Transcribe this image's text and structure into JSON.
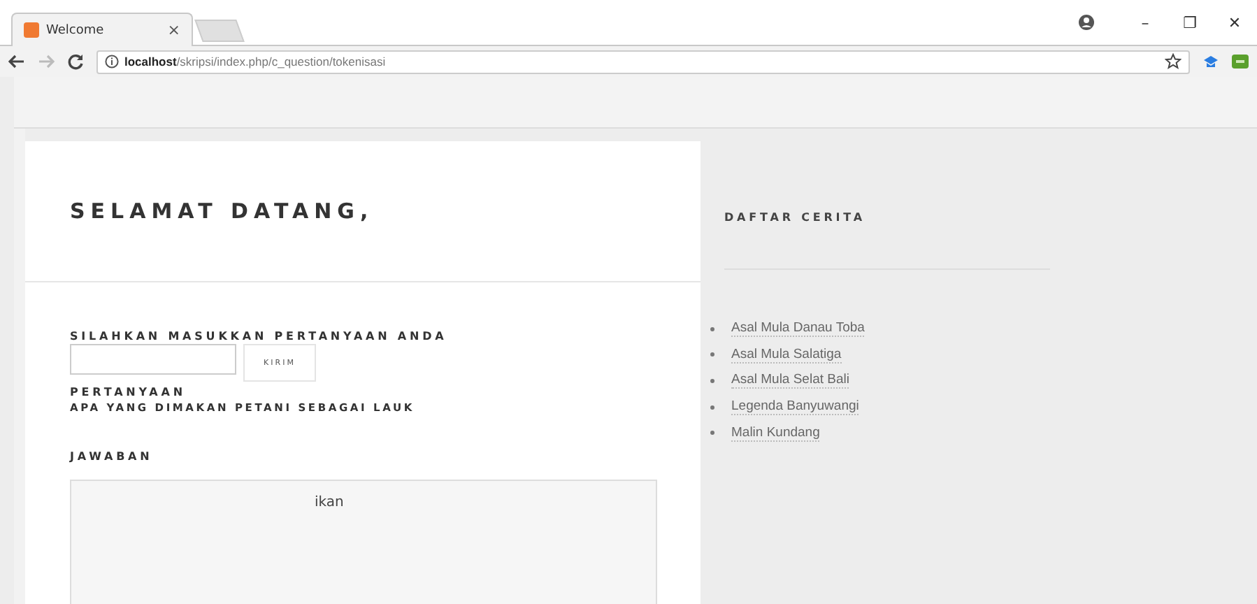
{
  "browser": {
    "tab_title": "Welcome",
    "close": "×",
    "url": "**localhost**/skripsi/index.php/c_question/tokenisasi",
    "window_controls": [
      "–",
      "❐",
      "✕"
    ]
  },
  "main": {
    "title": "SELAMAT DATANG,",
    "prompt": "SILAHKAN MASUKKAN PERTANYAAN ANDA",
    "submit": "KIRIM",
    "question_label": "PERTANYAAN",
    "question": "APA YANG DIMAKAN PETANI SEBAGAI LAUK",
    "answer_label": "JAWABAN",
    "answer": "ikan"
  },
  "sidebar": {
    "title": "DAFTAR CERITA",
    "items": [
      "Asal Mula Danau Toba",
      "Asal Mula Salatiga",
      "Asal Mula Selat Bali",
      "Legenda Banyuwangi",
      "Malin Kundang"
    ]
  }
}
